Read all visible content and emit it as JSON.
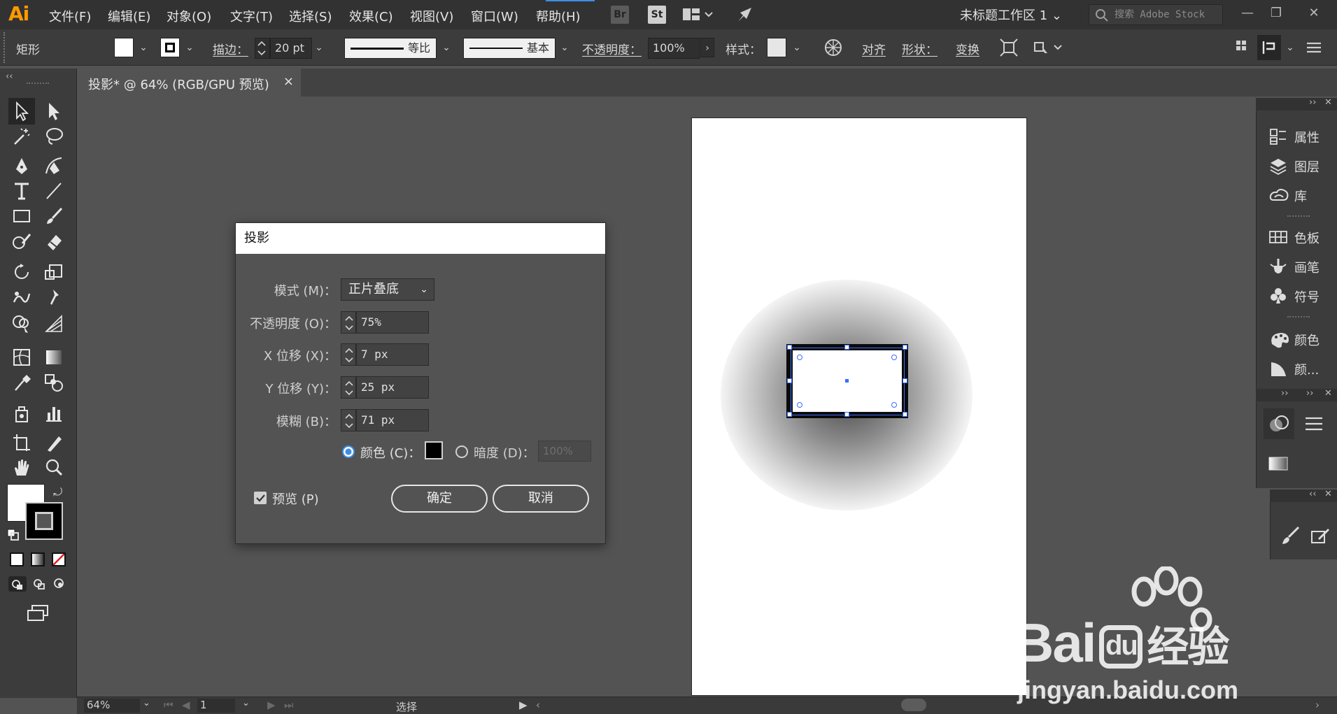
{
  "app": {
    "logo": "Ai",
    "menus": [
      "文件(F)",
      "编辑(E)",
      "对象(O)",
      "文字(T)",
      "选择(S)",
      "效果(C)",
      "视图(V)",
      "窗口(W)",
      "帮助(H)"
    ],
    "bridge_label": "Br",
    "stock_label": "St",
    "workspace": "未标题工作区 1",
    "search_placeholder": "搜索 Adobe Stock"
  },
  "control_bar": {
    "object_type": "矩形",
    "stroke_label": "描边：",
    "stroke_width": "20 pt",
    "profile_label": "等比",
    "brush_label": "基本",
    "opacity_label": "不透明度：",
    "opacity_value": "100%",
    "style_label": "样式：",
    "align_label": "对齐",
    "shape_label": "形状：",
    "transform_label": "变换"
  },
  "document": {
    "tab_title": "投影* @ 64% (RGB/GPU 预览)",
    "close": "×"
  },
  "panels": {
    "top": [
      {
        "icon": "properties-icon",
        "label": "属性"
      },
      {
        "icon": "layers-icon",
        "label": "图层"
      },
      {
        "icon": "libraries-icon",
        "label": "库"
      }
    ],
    "middle": [
      {
        "icon": "swatches-icon",
        "label": "色板"
      },
      {
        "icon": "brushes-icon",
        "label": "画笔"
      },
      {
        "icon": "symbols-icon",
        "label": "符号"
      }
    ],
    "bottom": [
      {
        "icon": "color-icon",
        "label": "颜色"
      },
      {
        "icon": "color-guide-icon",
        "label": "颜..."
      }
    ]
  },
  "dialog": {
    "title": "投影",
    "mode_label": "模式 (M)：",
    "mode_value": "正片叠底",
    "opacity_label": "不透明度 (O)：",
    "opacity_value": "75%",
    "x_label": "X 位移 (X)：",
    "x_value": "7 px",
    "y_label": "Y 位移 (Y)：",
    "y_value": "25 px",
    "blur_label": "模糊 (B)：",
    "blur_value": "71 px",
    "color_label": "颜色 (C)：",
    "darkness_label": "暗度 (D)：",
    "darkness_value": "100%",
    "preview_label": "预览 (P)",
    "ok_label": "确定",
    "cancel_label": "取消"
  },
  "status": {
    "zoom": "64%",
    "artboard": "1",
    "tool": "选择"
  },
  "watermark": {
    "brand": "Bai",
    "brand2": "du",
    "brand3": "经验",
    "url": "jingyan.baidu.com"
  }
}
